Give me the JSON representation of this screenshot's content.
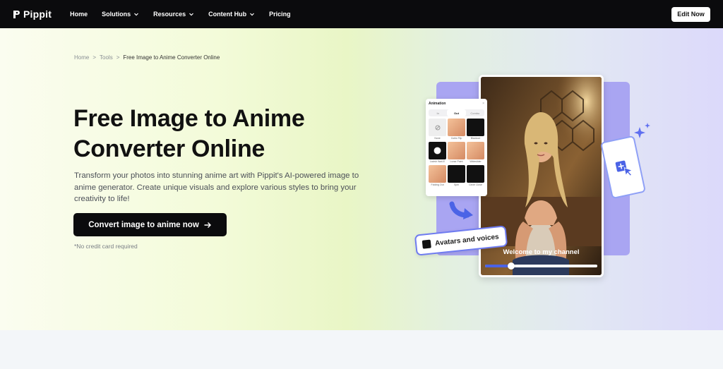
{
  "nav": {
    "brand": "Pippit",
    "items": [
      {
        "label": "Home",
        "dropdown": false
      },
      {
        "label": "Solutions",
        "dropdown": true
      },
      {
        "label": "Resources",
        "dropdown": true
      },
      {
        "label": "Content Hub",
        "dropdown": true
      },
      {
        "label": "Pricing",
        "dropdown": false
      }
    ],
    "cta": "Edit Now"
  },
  "breadcrumb": {
    "home": "Home",
    "tools": "Tools",
    "current": "Free Image to Anime Converter Online",
    "separator": ">"
  },
  "hero": {
    "title_line1": "Free Image to Anime",
    "title_line2": "Converter Online",
    "subtitle": "Transform your photos into stunning anime art with Pippit's AI-powered image to anime generator. Create unique visuals and explore various styles to bring your creativity to life!",
    "cta": "Convert image to anime now",
    "note": "*No credit card required"
  },
  "illustration": {
    "panel": {
      "title": "Animation",
      "tabs": [
        "In",
        "Out",
        "Combo"
      ],
      "active_tab": "Out",
      "items": [
        {
          "caption": "None",
          "style": "none"
        },
        {
          "caption": "Cubic Flip",
          "style": "face"
        },
        {
          "caption": "Blackout",
          "style": "dark"
        },
        {
          "caption": "Lavish Wall-E",
          "style": "burst"
        },
        {
          "caption": "Lunar Paint",
          "style": "face"
        },
        {
          "caption": "Wideslider",
          "style": "face"
        },
        {
          "caption": "Folding Out",
          "style": "face"
        },
        {
          "caption": "Spin",
          "style": "dark"
        },
        {
          "caption": "Circle Close",
          "style": "dark"
        }
      ]
    },
    "video_caption": "Welcome to my channel",
    "video_progress": 0.23,
    "badge": "Avatars and voices"
  },
  "colors": {
    "accent": "#4b63e6",
    "purple_bg": "#a9a5f2",
    "nav_bg": "#0b0b0d"
  }
}
